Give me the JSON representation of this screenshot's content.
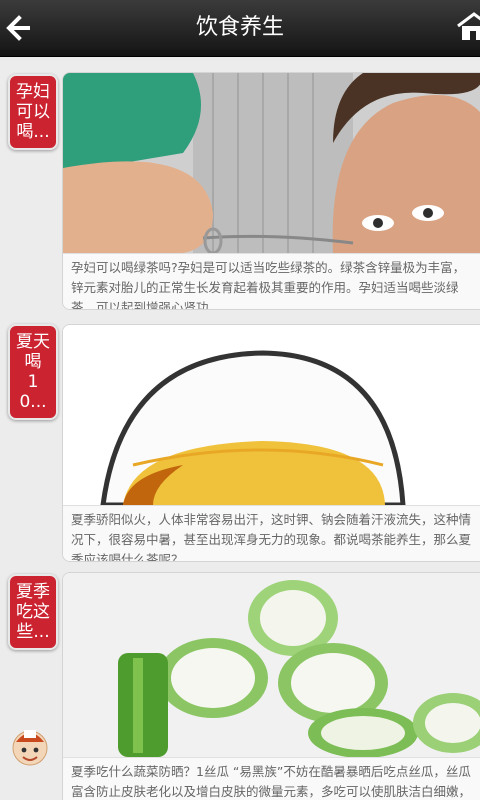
{
  "header": {
    "title": "饮食养生",
    "back_icon": "arrow-left-icon",
    "home_icon": "home-icon"
  },
  "articles": [
    {
      "tag": "孕妇可以喝...",
      "tag_lines": [
        "孕妇",
        "可以",
        "喝..."
      ],
      "summary": "孕妇可以喝绿茶吗?孕妇是可以适当吃些绿茶的。绿茶含锌量极为丰富，锌元素对胎儿的正常生长发育起着极其重要的作用。孕妇适当喝些淡绿茶，可以起到增强心肾功"
    },
    {
      "tag": "夏天喝10...",
      "tag_lines": [
        "夏天",
        "喝",
        "10..."
      ],
      "summary": "夏季骄阳似火，人体非常容易出汗，这时钾、钠会随着汗液流失，这种情况下，很容易中暑，甚至出现浑身无力的现象。都说喝茶能养生，那么夏季应该喝什么茶呢？"
    },
    {
      "tag": "夏季吃这些...",
      "tag_lines": [
        "夏季",
        "吃这",
        "些..."
      ],
      "summary": "夏季吃什么蔬菜防晒？1丝瓜 “易黑族”不妨在酷暑暴晒后吃点丝瓜，丝瓜富含防止皮肤老化以及增白皮肤的微量元素，多吃可以使肌肤洁白细嫩，长期食用丝瓜或用丝"
    }
  ],
  "floating": {
    "avatar_icon": "mascot-avatar-icon"
  }
}
